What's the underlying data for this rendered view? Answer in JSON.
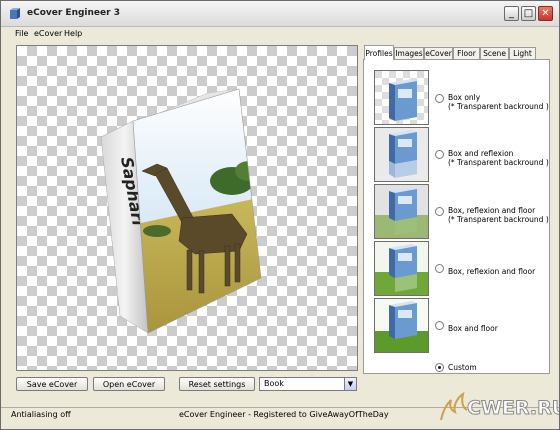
{
  "window": {
    "title": "eCover Engineer 3",
    "minimize_glyph": "_",
    "maximize_glyph": "□",
    "close_glyph": "✕"
  },
  "menu": [
    "File",
    "eCover",
    "Help"
  ],
  "preview": {
    "book_spine_text": "Saphari"
  },
  "buttons": {
    "save": "Save eCover",
    "open": "Open eCover",
    "reset": "Reset settings"
  },
  "dropdown": {
    "value": "Book",
    "arrow": "▼"
  },
  "tabs": [
    "Profiles",
    "Images",
    "eCover",
    "Floor",
    "Scene",
    "Light"
  ],
  "active_tab": "Profiles",
  "profiles": [
    {
      "title": "Box only",
      "note": "(* Transparent backround )",
      "selected": false
    },
    {
      "title": "Box and reflexion",
      "note": "(* Transparent backround )",
      "selected": false
    },
    {
      "title": "Box, reflexion and floor",
      "note": "(* Transparent backround )",
      "selected": false
    },
    {
      "title": "Box, reflexion and floor",
      "note": "",
      "selected": false
    },
    {
      "title": "Box and floor",
      "note": "",
      "selected": false
    }
  ],
  "custom": {
    "label": "Custom",
    "selected": true
  },
  "status": {
    "left": "Antialiasing off",
    "center": "eCover Engineer - Registered to GiveAwayOfTheDay"
  },
  "watermark": "CWER.RU",
  "colors": {
    "box_blue": "#5b8fc8",
    "floor_green": "#6fa838",
    "savanna": "#c9b85a",
    "sky": "#b9d7ee"
  }
}
